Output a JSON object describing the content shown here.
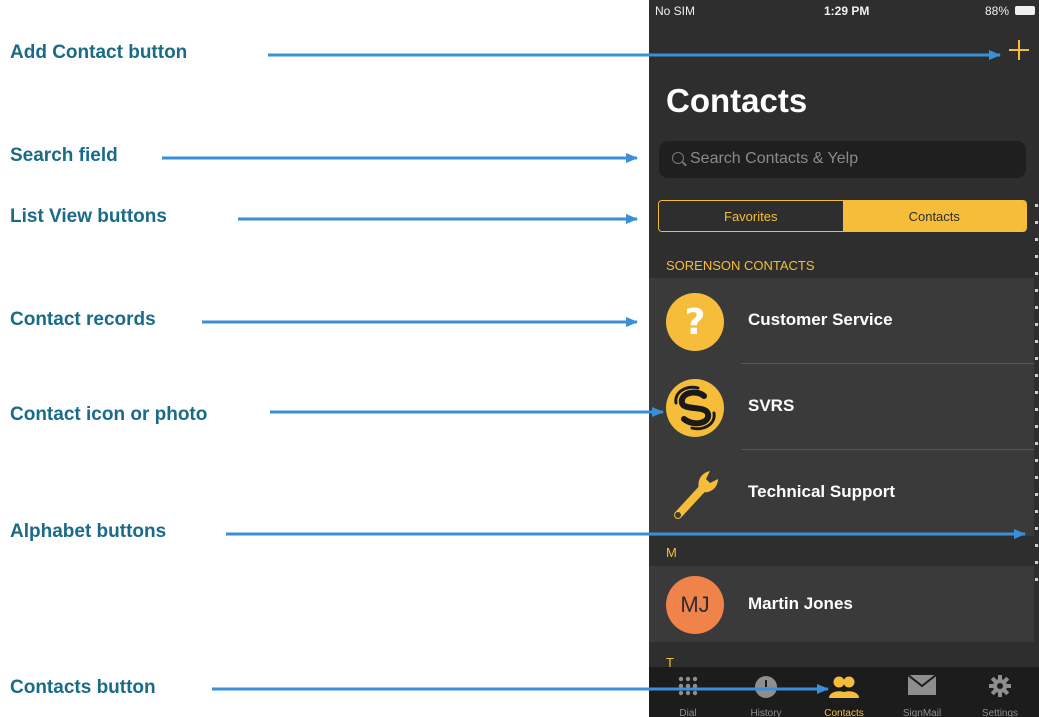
{
  "callouts": [
    {
      "label": "Add Contact button"
    },
    {
      "label": "Search field"
    },
    {
      "label": "List View buttons"
    },
    {
      "label": "Contact records"
    },
    {
      "label": "Contact icon or photo"
    },
    {
      "label": "Alphabet buttons"
    },
    {
      "label": "Contacts button"
    }
  ],
  "status_bar": {
    "carrier": "No SIM",
    "time": "1:29 PM",
    "battery": "88%"
  },
  "header": {
    "title": "Contacts",
    "add_icon": "plus-icon"
  },
  "search": {
    "placeholder": "Search Contacts & Yelp",
    "icon": "search-icon"
  },
  "segments": {
    "favorites": "Favorites",
    "contacts": "Contacts",
    "selected": "Contacts"
  },
  "sections": [
    {
      "header": "SORENSON CONTACTS",
      "contacts": [
        {
          "name": "Customer Service",
          "icon": "question-mark-icon"
        },
        {
          "name": "SVRS",
          "icon": "sorenson-logo-icon"
        },
        {
          "name": "Technical Support",
          "icon": "wrench-icon"
        }
      ]
    },
    {
      "header": "M",
      "contacts": [
        {
          "name": "Martin Jones",
          "initials": "MJ"
        }
      ]
    },
    {
      "header": "T",
      "contacts": []
    }
  ],
  "tab_bar": [
    {
      "label": "Dial",
      "icon": "keypad-icon"
    },
    {
      "label": "History",
      "icon": "clock-icon"
    },
    {
      "label": "Contacts",
      "icon": "people-icon",
      "active": true
    },
    {
      "label": "SignMail",
      "icon": "envelope-icon"
    },
    {
      "label": "Settings",
      "icon": "gear-icon"
    }
  ],
  "colors": {
    "accent": "#f6bd3a",
    "callout_text": "#1a6b8a",
    "arrow": "#3a8fd9",
    "phone_bg": "#2e2e2e",
    "row_bg": "#3a3a3a",
    "avatar_mj": "#f0834a"
  }
}
